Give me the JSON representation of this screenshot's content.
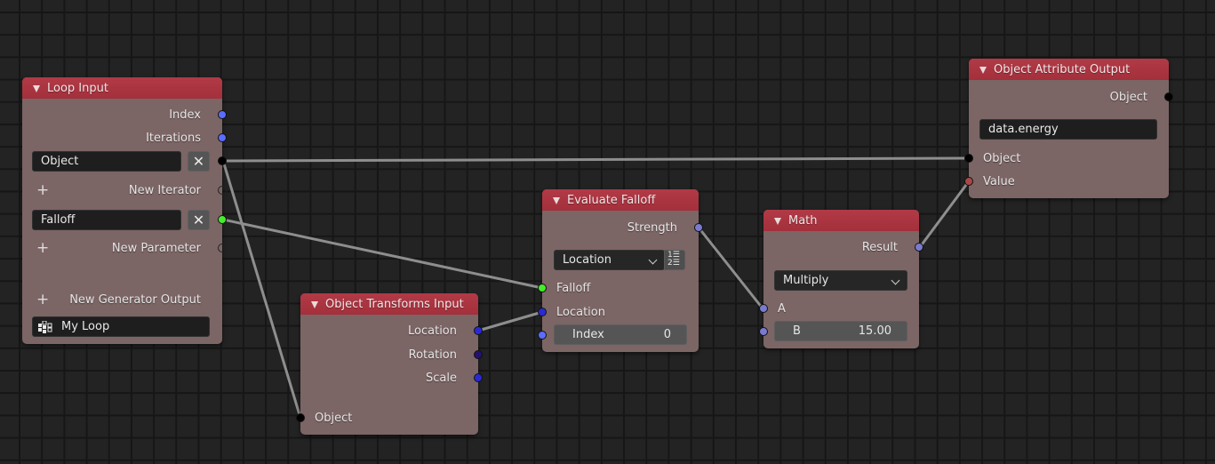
{
  "editor": {
    "type": "node-editor",
    "colors": {
      "header": "#a83440",
      "node_body": "#7c6565",
      "background": "#232323",
      "wire": "#8e8e8e",
      "socket_object": "#000000",
      "socket_integer": "#5a6dff",
      "socket_falloff": "#44ee2a",
      "socket_vector": "#2a2ad4",
      "socket_rotation": "#23136e",
      "socket_float": "#7a7ad0",
      "socket_generic": "#a84848"
    }
  },
  "nodes": {
    "loop_input": {
      "title": "Loop Input",
      "outputs": {
        "index": "Index",
        "iterations": "Iterations"
      },
      "iterator_field": "Object",
      "new_iterator": "New Iterator",
      "parameter_field": "Falloff",
      "new_parameter": "New Parameter",
      "new_generator_output": "New Generator Output",
      "loop_name": "My Loop",
      "remove_symbol": "✕",
      "add_symbol": "+"
    },
    "object_transforms_input": {
      "title": "Object Transforms Input",
      "outputs": {
        "location": "Location",
        "rotation": "Rotation",
        "scale": "Scale"
      },
      "inputs": {
        "object": "Object"
      }
    },
    "evaluate_falloff": {
      "title": "Evaluate Falloff",
      "outputs": {
        "strength": "Strength"
      },
      "mode_dropdown": "Location",
      "list_toggle": {
        "line1": "1☰",
        "line2": "2☰"
      },
      "inputs": {
        "falloff": "Falloff",
        "location": "Location",
        "index_label": "Index",
        "index_value": "0"
      }
    },
    "math": {
      "title": "Math",
      "outputs": {
        "result": "Result"
      },
      "operation": "Multiply",
      "inputs": {
        "a": "A",
        "b_label": "B",
        "b_value": "15.00"
      }
    },
    "object_attribute_output": {
      "title": "Object Attribute Output",
      "outputs": {
        "object": "Object"
      },
      "attribute_path": "data.energy",
      "inputs": {
        "object": "Object",
        "value": "Value"
      }
    }
  },
  "links": [
    {
      "from": "loop_input.object",
      "to": "object_attribute_output.object"
    },
    {
      "from": "loop_input.object",
      "to": "object_transforms_input.object"
    },
    {
      "from": "loop_input.falloff",
      "to": "evaluate_falloff.falloff"
    },
    {
      "from": "object_transforms_input.location",
      "to": "evaluate_falloff.location"
    },
    {
      "from": "evaluate_falloff.strength",
      "to": "math.a"
    },
    {
      "from": "math.result",
      "to": "object_attribute_output.value"
    }
  ]
}
